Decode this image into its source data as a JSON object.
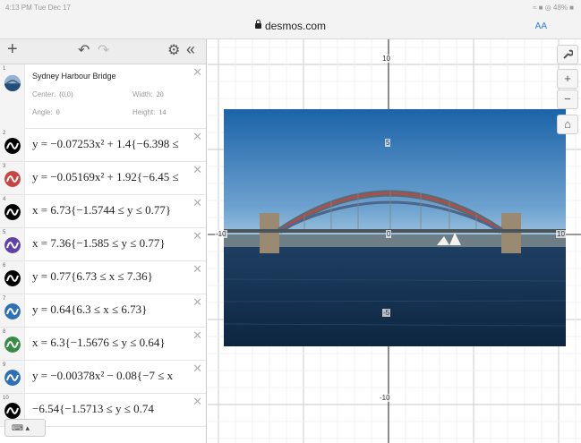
{
  "status": {
    "time": "4:13 PM  Tue Dec 17",
    "right": "≈ ■ ◎ 48% ■"
  },
  "browser": {
    "url": "desmos.com",
    "reader": "AA"
  },
  "toolbar": {
    "add": "+",
    "undo": "↶",
    "redo": "↷",
    "settings": "⚙",
    "collapse": "«"
  },
  "image_item": {
    "num": "1",
    "title": "Sydney Harbour Bridge",
    "center_label": "Center:",
    "center_value": "(0,0)",
    "width_label": "Width:",
    "width_value": "20",
    "angle_label": "Angle:",
    "angle_value": "0",
    "height_label": "Height:",
    "height_value": "14"
  },
  "expressions": [
    {
      "num": "2",
      "color": "#000000",
      "latex": "y = −0.07253x² + 1.4{−6.398 ≤"
    },
    {
      "num": "3",
      "color": "#c74440",
      "latex": "y = −0.05169x² + 1.92{−6.45 ≤"
    },
    {
      "num": "4",
      "color": "#000000",
      "latex": "x = 6.73{−1.5744 ≤ y ≤ 0.77}"
    },
    {
      "num": "5",
      "color": "#6042a6",
      "latex": "x = 7.36{−1.585 ≤ y ≤ 0.77}"
    },
    {
      "num": "6",
      "color": "#000000",
      "latex": "y = 0.77{6.73 ≤ x ≤ 7.36}"
    },
    {
      "num": "7",
      "color": "#2d70b3",
      "latex": "y = 0.64{6.3 ≤ x ≤ 6.73}"
    },
    {
      "num": "8",
      "color": "#388c46",
      "latex": "x = 6.3{−1.5676 ≤ y ≤ 0.64}"
    },
    {
      "num": "9",
      "color": "#2d70b3",
      "latex": "y = −0.00378x² − 0.08{−7 ≤ x"
    },
    {
      "num": "10",
      "color": "#000000",
      "latex": "−6.54{−1.5713 ≤ y ≤ 0.74"
    }
  ],
  "keyboard": {
    "label": "⌨ ▴"
  },
  "graph": {
    "tick_labels": {
      "x_neg10": "-10",
      "x_0": "0",
      "x_10": "10",
      "y_10": "10",
      "y_5": "5",
      "y_neg5": "-5",
      "y_neg10": "-10"
    },
    "buttons": {
      "wrench": "🔧",
      "zoom_in": "+",
      "zoom_out": "−",
      "home": "⌂"
    }
  }
}
